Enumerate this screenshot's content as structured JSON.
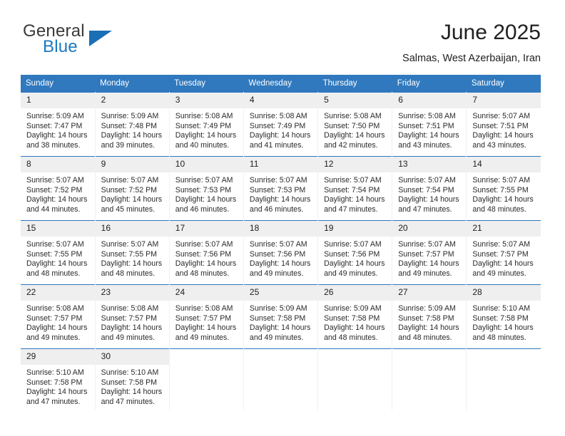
{
  "brand": {
    "name_top": "General",
    "name_bottom": "Blue",
    "color_top": "#3a3a3a",
    "color_bottom": "#1b79c0",
    "triangle_color": "#1b6fb5",
    "icon": "triangle-icon"
  },
  "header": {
    "title": "June 2025",
    "subtitle": "Salmas, West Azerbaijan, Iran"
  },
  "theme": {
    "header_bg": "#3079be",
    "row_divider": "#2e77bd",
    "daynum_bg": "#efefef"
  },
  "weekday_headers": [
    "Sunday",
    "Monday",
    "Tuesday",
    "Wednesday",
    "Thursday",
    "Friday",
    "Saturday"
  ],
  "weeks": [
    [
      {
        "day": "1",
        "sunrise": "Sunrise: 5:09 AM",
        "sunset": "Sunset: 7:47 PM",
        "daylight_1": "Daylight: 14 hours",
        "daylight_2": "and 38 minutes."
      },
      {
        "day": "2",
        "sunrise": "Sunrise: 5:09 AM",
        "sunset": "Sunset: 7:48 PM",
        "daylight_1": "Daylight: 14 hours",
        "daylight_2": "and 39 minutes."
      },
      {
        "day": "3",
        "sunrise": "Sunrise: 5:08 AM",
        "sunset": "Sunset: 7:49 PM",
        "daylight_1": "Daylight: 14 hours",
        "daylight_2": "and 40 minutes."
      },
      {
        "day": "4",
        "sunrise": "Sunrise: 5:08 AM",
        "sunset": "Sunset: 7:49 PM",
        "daylight_1": "Daylight: 14 hours",
        "daylight_2": "and 41 minutes."
      },
      {
        "day": "5",
        "sunrise": "Sunrise: 5:08 AM",
        "sunset": "Sunset: 7:50 PM",
        "daylight_1": "Daylight: 14 hours",
        "daylight_2": "and 42 minutes."
      },
      {
        "day": "6",
        "sunrise": "Sunrise: 5:08 AM",
        "sunset": "Sunset: 7:51 PM",
        "daylight_1": "Daylight: 14 hours",
        "daylight_2": "and 43 minutes."
      },
      {
        "day": "7",
        "sunrise": "Sunrise: 5:07 AM",
        "sunset": "Sunset: 7:51 PM",
        "daylight_1": "Daylight: 14 hours",
        "daylight_2": "and 43 minutes."
      }
    ],
    [
      {
        "day": "8",
        "sunrise": "Sunrise: 5:07 AM",
        "sunset": "Sunset: 7:52 PM",
        "daylight_1": "Daylight: 14 hours",
        "daylight_2": "and 44 minutes."
      },
      {
        "day": "9",
        "sunrise": "Sunrise: 5:07 AM",
        "sunset": "Sunset: 7:52 PM",
        "daylight_1": "Daylight: 14 hours",
        "daylight_2": "and 45 minutes."
      },
      {
        "day": "10",
        "sunrise": "Sunrise: 5:07 AM",
        "sunset": "Sunset: 7:53 PM",
        "daylight_1": "Daylight: 14 hours",
        "daylight_2": "and 46 minutes."
      },
      {
        "day": "11",
        "sunrise": "Sunrise: 5:07 AM",
        "sunset": "Sunset: 7:53 PM",
        "daylight_1": "Daylight: 14 hours",
        "daylight_2": "and 46 minutes."
      },
      {
        "day": "12",
        "sunrise": "Sunrise: 5:07 AM",
        "sunset": "Sunset: 7:54 PM",
        "daylight_1": "Daylight: 14 hours",
        "daylight_2": "and 47 minutes."
      },
      {
        "day": "13",
        "sunrise": "Sunrise: 5:07 AM",
        "sunset": "Sunset: 7:54 PM",
        "daylight_1": "Daylight: 14 hours",
        "daylight_2": "and 47 minutes."
      },
      {
        "day": "14",
        "sunrise": "Sunrise: 5:07 AM",
        "sunset": "Sunset: 7:55 PM",
        "daylight_1": "Daylight: 14 hours",
        "daylight_2": "and 48 minutes."
      }
    ],
    [
      {
        "day": "15",
        "sunrise": "Sunrise: 5:07 AM",
        "sunset": "Sunset: 7:55 PM",
        "daylight_1": "Daylight: 14 hours",
        "daylight_2": "and 48 minutes."
      },
      {
        "day": "16",
        "sunrise": "Sunrise: 5:07 AM",
        "sunset": "Sunset: 7:55 PM",
        "daylight_1": "Daylight: 14 hours",
        "daylight_2": "and 48 minutes."
      },
      {
        "day": "17",
        "sunrise": "Sunrise: 5:07 AM",
        "sunset": "Sunset: 7:56 PM",
        "daylight_1": "Daylight: 14 hours",
        "daylight_2": "and 48 minutes."
      },
      {
        "day": "18",
        "sunrise": "Sunrise: 5:07 AM",
        "sunset": "Sunset: 7:56 PM",
        "daylight_1": "Daylight: 14 hours",
        "daylight_2": "and 49 minutes."
      },
      {
        "day": "19",
        "sunrise": "Sunrise: 5:07 AM",
        "sunset": "Sunset: 7:56 PM",
        "daylight_1": "Daylight: 14 hours",
        "daylight_2": "and 49 minutes."
      },
      {
        "day": "20",
        "sunrise": "Sunrise: 5:07 AM",
        "sunset": "Sunset: 7:57 PM",
        "daylight_1": "Daylight: 14 hours",
        "daylight_2": "and 49 minutes."
      },
      {
        "day": "21",
        "sunrise": "Sunrise: 5:07 AM",
        "sunset": "Sunset: 7:57 PM",
        "daylight_1": "Daylight: 14 hours",
        "daylight_2": "and 49 minutes."
      }
    ],
    [
      {
        "day": "22",
        "sunrise": "Sunrise: 5:08 AM",
        "sunset": "Sunset: 7:57 PM",
        "daylight_1": "Daylight: 14 hours",
        "daylight_2": "and 49 minutes."
      },
      {
        "day": "23",
        "sunrise": "Sunrise: 5:08 AM",
        "sunset": "Sunset: 7:57 PM",
        "daylight_1": "Daylight: 14 hours",
        "daylight_2": "and 49 minutes."
      },
      {
        "day": "24",
        "sunrise": "Sunrise: 5:08 AM",
        "sunset": "Sunset: 7:57 PM",
        "daylight_1": "Daylight: 14 hours",
        "daylight_2": "and 49 minutes."
      },
      {
        "day": "25",
        "sunrise": "Sunrise: 5:09 AM",
        "sunset": "Sunset: 7:58 PM",
        "daylight_1": "Daylight: 14 hours",
        "daylight_2": "and 49 minutes."
      },
      {
        "day": "26",
        "sunrise": "Sunrise: 5:09 AM",
        "sunset": "Sunset: 7:58 PM",
        "daylight_1": "Daylight: 14 hours",
        "daylight_2": "and 48 minutes."
      },
      {
        "day": "27",
        "sunrise": "Sunrise: 5:09 AM",
        "sunset": "Sunset: 7:58 PM",
        "daylight_1": "Daylight: 14 hours",
        "daylight_2": "and 48 minutes."
      },
      {
        "day": "28",
        "sunrise": "Sunrise: 5:10 AM",
        "sunset": "Sunset: 7:58 PM",
        "daylight_1": "Daylight: 14 hours",
        "daylight_2": "and 48 minutes."
      }
    ],
    [
      {
        "day": "29",
        "sunrise": "Sunrise: 5:10 AM",
        "sunset": "Sunset: 7:58 PM",
        "daylight_1": "Daylight: 14 hours",
        "daylight_2": "and 47 minutes."
      },
      {
        "day": "30",
        "sunrise": "Sunrise: 5:10 AM",
        "sunset": "Sunset: 7:58 PM",
        "daylight_1": "Daylight: 14 hours",
        "daylight_2": "and 47 minutes."
      },
      null,
      null,
      null,
      null,
      null
    ]
  ]
}
